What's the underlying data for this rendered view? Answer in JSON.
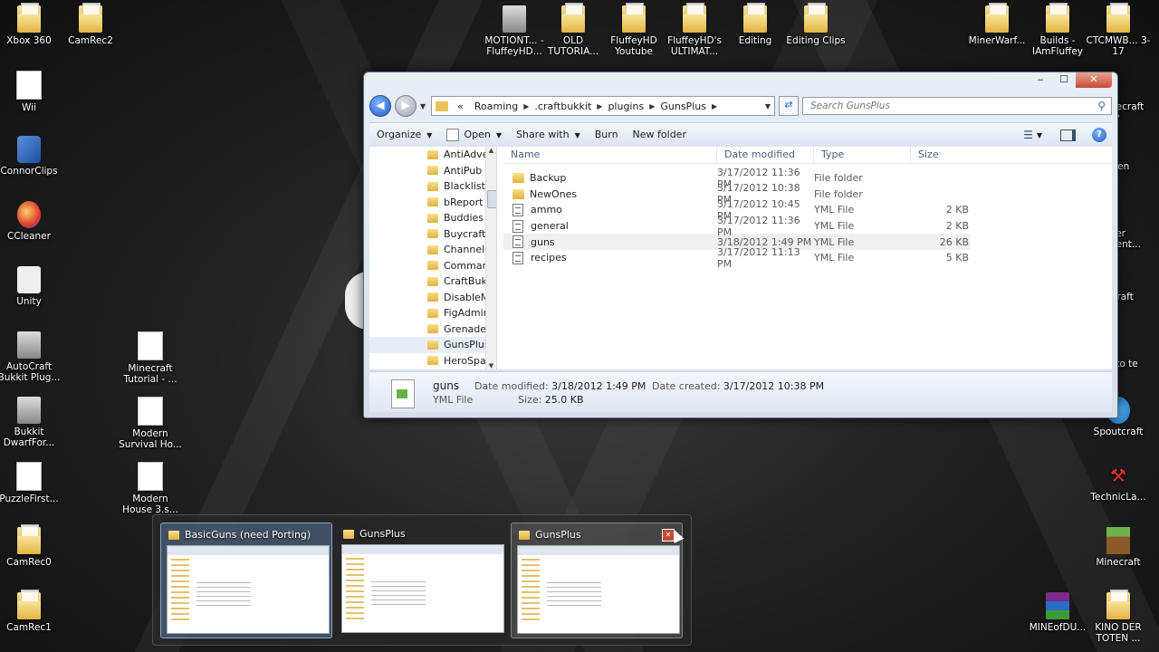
{
  "desktop": {
    "icons_left": [
      {
        "label": "Xbox 360",
        "kind": "folder"
      },
      {
        "label": "CamRec2",
        "kind": "folder"
      },
      {
        "label": "Wii",
        "kind": "doc"
      },
      {
        "label": "ConnorClips",
        "kind": "app"
      },
      {
        "label": "CCleaner",
        "kind": "red"
      },
      {
        "label": "Unity",
        "kind": "unity"
      },
      {
        "label": "AutoCraft Bukkit Plug...",
        "kind": "drive"
      },
      {
        "label": "Minecraft Tutorial - ...",
        "kind": "doc"
      },
      {
        "label": "Bukkit DwarfFor...",
        "kind": "drive"
      },
      {
        "label": "Modern Survival Ho...",
        "kind": "doc"
      },
      {
        "label": "PuzzleFirst...",
        "kind": "doc"
      },
      {
        "label": "Modern House 3.s...",
        "kind": "doc"
      },
      {
        "label": "CamRec0",
        "kind": "folder"
      },
      {
        "label": "CamRec1",
        "kind": "folder"
      }
    ],
    "icons_top": [
      {
        "label": "MOTIONT... - FluffeyHD...",
        "kind": "drive"
      },
      {
        "label": "OLD TUTORIA...",
        "kind": "folder"
      },
      {
        "label": "FluffeyHD Youtube",
        "kind": "folder"
      },
      {
        "label": "FluffeyHD's ULTIMAT...",
        "kind": "folder"
      },
      {
        "label": "Editing",
        "kind": "folder"
      },
      {
        "label": "Editing Clips",
        "kind": "folder"
      }
    ],
    "icons_right": [
      {
        "label": "MinerWarf...",
        "kind": "folder"
      },
      {
        "label": "Builds - IAmFluffey",
        "kind": "folder"
      },
      {
        "label": "CTCMWB... 3-17",
        "kind": "folder"
      },
      {
        "label": "Spoutcraft",
        "kind": "blue"
      },
      {
        "label": "TechnicLa...",
        "kind": "tech"
      },
      {
        "label": "Minecraft",
        "kind": "green"
      },
      {
        "label": "MINEofDU...",
        "kind": "rar"
      },
      {
        "label": "KINO DER TOTEN ...",
        "kind": "folder"
      }
    ],
    "partial_right_labels": [
      "necraft rv",
      "Gen",
      "ver nent...",
      "Craft",
      "l to te"
    ]
  },
  "explorer": {
    "caption": {
      "minimize": "‒",
      "maximize": "☐",
      "close": "✕"
    },
    "breadcrumb": [
      "Roaming",
      ".craftbukkit",
      "plugins",
      "GunsPlus"
    ],
    "breadcrumb_prefix": "«",
    "search_placeholder": "Search GunsPlus",
    "toolbar": {
      "organize": "Organize",
      "open": "Open",
      "share_with": "Share with",
      "burn": "Burn",
      "new_folder": "New folder"
    },
    "nav_items": [
      "AntiAdve",
      "AntiPub",
      "BlacklistC",
      "bReport",
      "Buddies",
      "Buycraft",
      "ChannelC",
      "Comman",
      "CraftBukl",
      "DisableM",
      "FigAdmir",
      "Grenades",
      "GunsPlus",
      "HeroSpav"
    ],
    "nav_selected": "GunsPlus",
    "columns": {
      "name": "Name",
      "date": "Date modified",
      "type": "Type",
      "size": "Size"
    },
    "files": [
      {
        "name": "Backup",
        "date": "3/17/2012 11:36 PM",
        "type": "File folder",
        "size": "",
        "kind": "folder"
      },
      {
        "name": "NewOnes",
        "date": "3/17/2012 10:38 PM",
        "type": "File folder",
        "size": "",
        "kind": "folder"
      },
      {
        "name": "ammo",
        "date": "3/17/2012 10:45 PM",
        "type": "YML File",
        "size": "2 KB",
        "kind": "file"
      },
      {
        "name": "general",
        "date": "3/17/2012 11:36 PM",
        "type": "YML File",
        "size": "2 KB",
        "kind": "file"
      },
      {
        "name": "guns",
        "date": "3/18/2012 1:49 PM",
        "type": "YML File",
        "size": "26 KB",
        "kind": "file",
        "selected": true
      },
      {
        "name": "recipes",
        "date": "3/17/2012 11:13 PM",
        "type": "YML File",
        "size": "5 KB",
        "kind": "file"
      }
    ],
    "details": {
      "name": "guns",
      "type": "YML File",
      "date_modified_label": "Date modified:",
      "date_modified": "3/18/2012 1:49 PM",
      "size_label": "Size:",
      "size": "25.0 KB",
      "date_created_label": "Date created:",
      "date_created": "3/17/2012 10:38 PM"
    }
  },
  "taskbar_thumbnails": [
    {
      "title": "BasicGuns (need Porting)",
      "state": "active"
    },
    {
      "title": "GunsPlus",
      "state": "normal"
    },
    {
      "title": "GunsPlus",
      "state": "hover"
    }
  ]
}
